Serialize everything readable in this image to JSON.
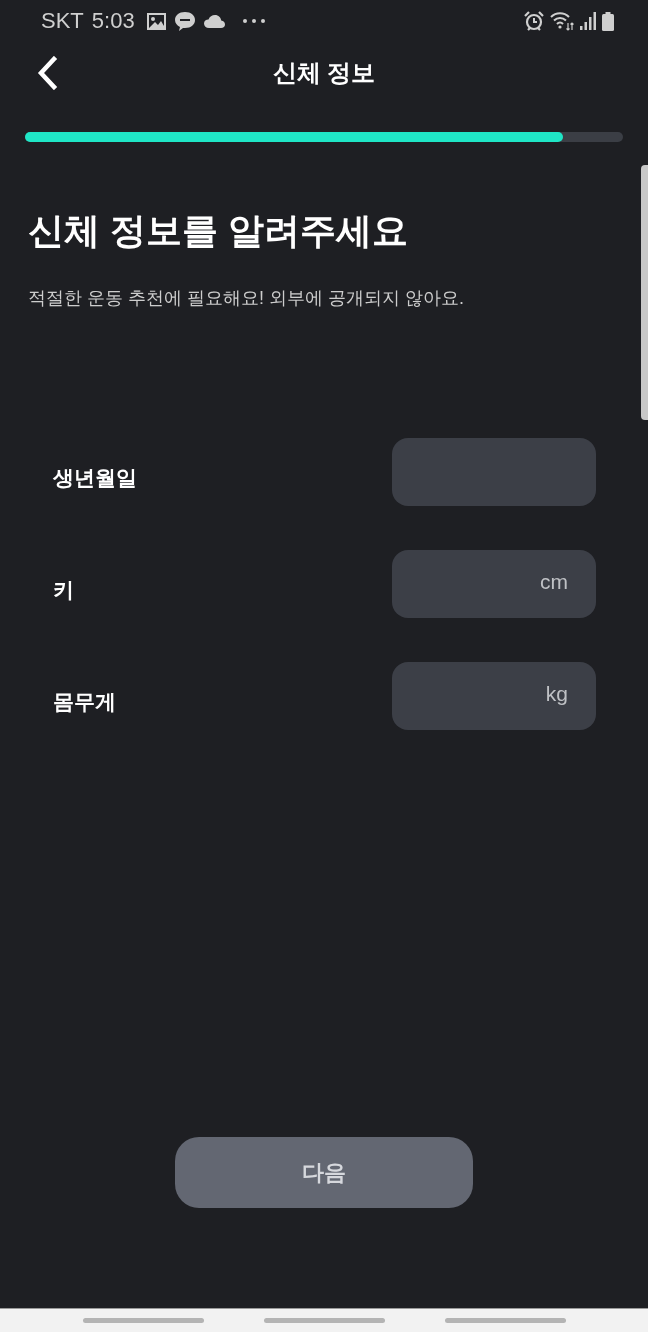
{
  "status_bar": {
    "carrier": "SKT",
    "time": "5:03"
  },
  "header": {
    "title": "신체 정보"
  },
  "progress": {
    "level": 0.9
  },
  "intro": {
    "heading": "신체 정보를 알려주세요",
    "subtitle": "적절한 운동 추천에 필요해요! 외부에 공개되지 않아요."
  },
  "form": {
    "fields": [
      {
        "label": "생년월일"
      },
      {
        "label": "키",
        "unit": "cm"
      },
      {
        "label": "몸무게",
        "unit": "kg"
      }
    ]
  },
  "next_button": {
    "label": "다음",
    "disabled": true
  }
}
